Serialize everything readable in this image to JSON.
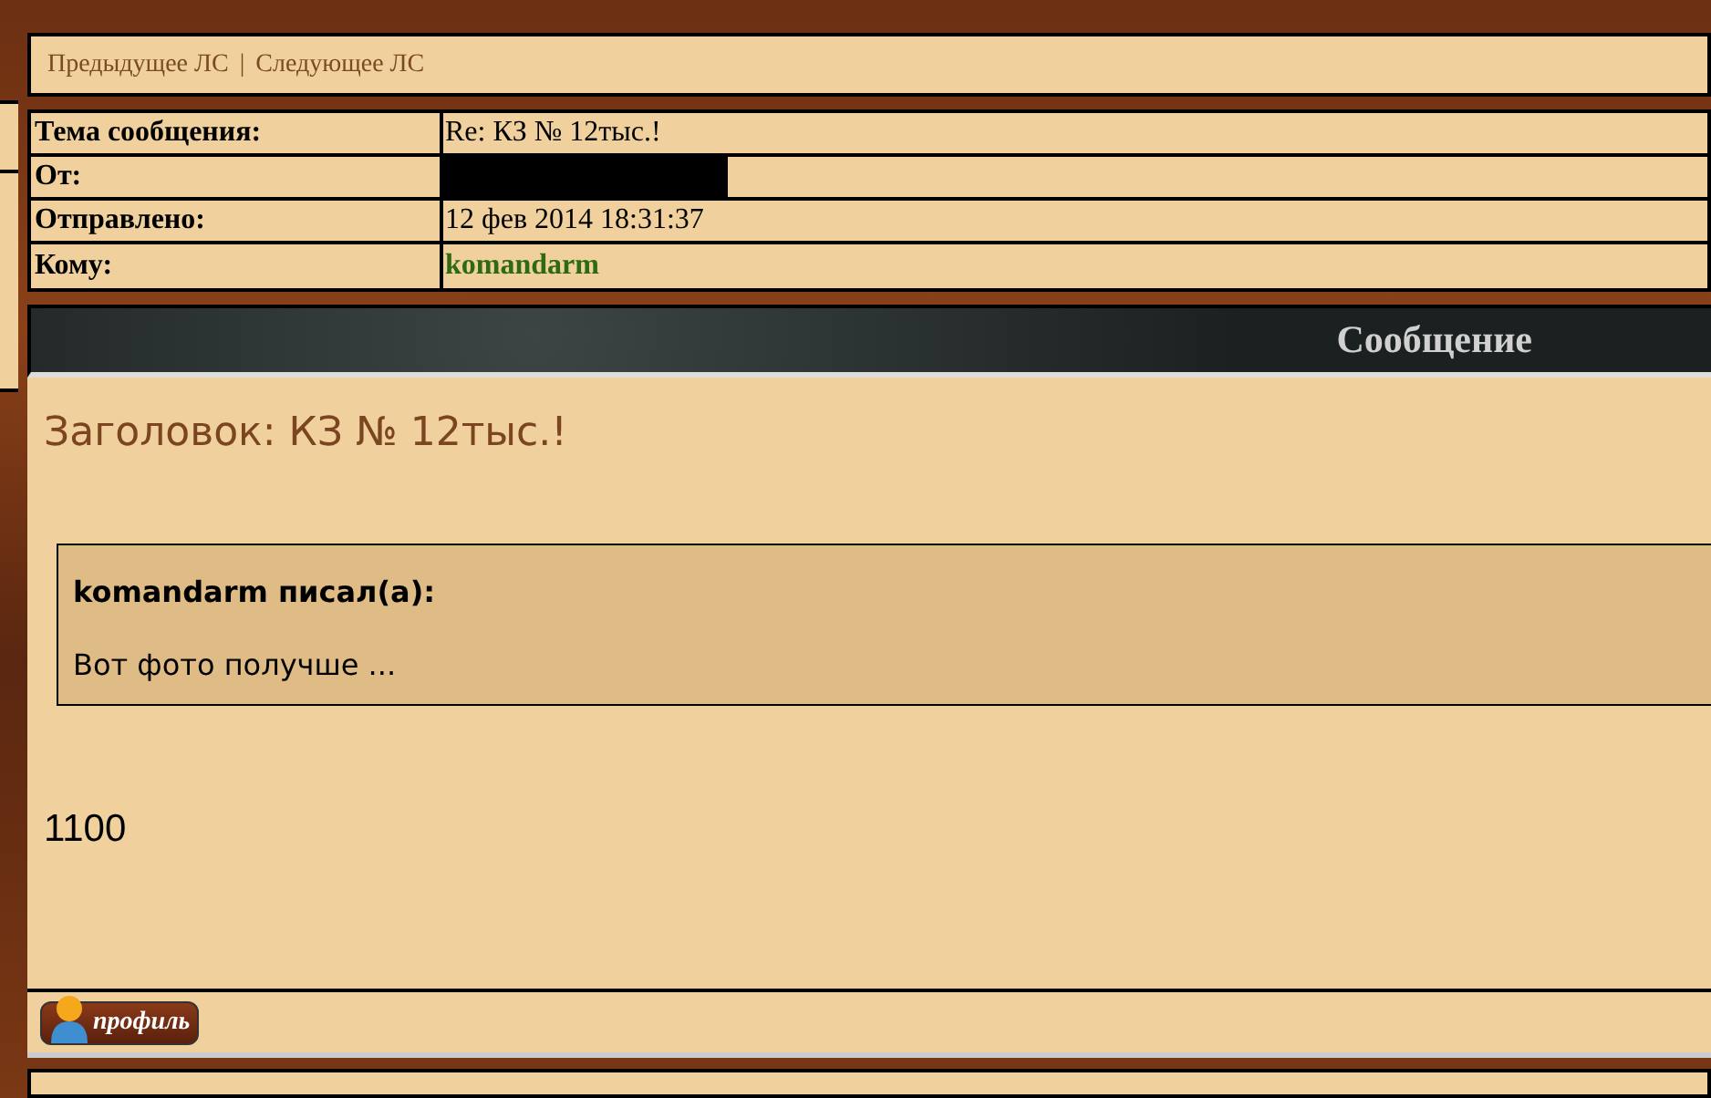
{
  "nav": {
    "prev": "Предыдущее ЛС",
    "separator": "|",
    "next": "Следующее ЛС"
  },
  "headers": [
    {
      "label": "Тема сообщения:",
      "value": "Re: КЗ № 12тыс.!",
      "kind": "text"
    },
    {
      "label": "От:",
      "kind": "redacted"
    },
    {
      "label": "Отправлено:",
      "value": "12 фев 2014 18:31:37",
      "kind": "text"
    },
    {
      "label": "Кому:",
      "value": "komandarm",
      "kind": "user"
    }
  ],
  "section_title": "Сообщение",
  "message": {
    "title": "Заголовок: КЗ № 12тыс.!",
    "quote": {
      "author": "komandarm писал(а):",
      "text": "Вот фото получше ..."
    },
    "body": "1100"
  },
  "profile_button": "профиль"
}
